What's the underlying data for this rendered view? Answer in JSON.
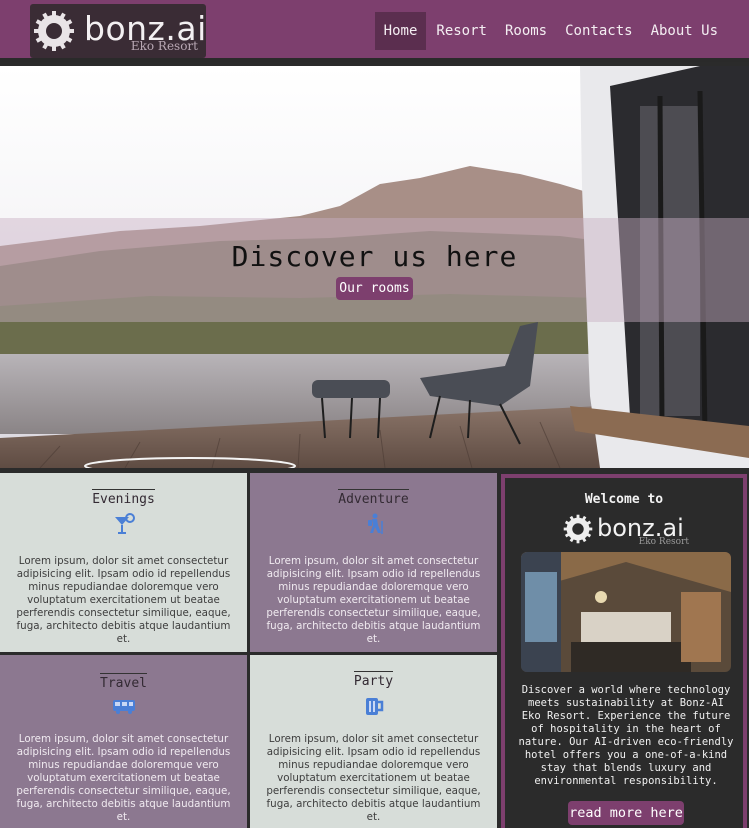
{
  "header": {
    "logo": {
      "brand": "bonz.ai",
      "subtitle": "Eko Resort",
      "icon": "gear-logo-icon"
    },
    "nav": [
      {
        "label": "Home",
        "active": true
      },
      {
        "label": "Resort",
        "active": false
      },
      {
        "label": "Rooms",
        "active": false
      },
      {
        "label": "Contacts",
        "active": false
      },
      {
        "label": "About Us",
        "active": false
      }
    ]
  },
  "hero": {
    "title": "Discover us here",
    "button_label": "Our rooms"
  },
  "cards": [
    {
      "title": "Evenings",
      "icon": "cocktail-icon",
      "text": "Lorem ipsum, dolor sit amet consectetur adipisicing elit. Ipsam odio id repellendus minus repudiandae doloremque vero voluptatum exercitationem ut beatae perferendis consectetur similique, eaque, fuga, architecto debitis atque laudantium et."
    },
    {
      "title": "Adventure",
      "icon": "hiking-icon",
      "text": "Lorem ipsum, dolor sit amet consectetur adipisicing elit. Ipsam odio id repellendus minus repudiandae doloremque vero voluptatum exercitationem ut beatae perferendis consectetur similique, eaque, fuga, architecto debitis atque laudantium et."
    },
    {
      "title": "Travel",
      "icon": "bus-icon",
      "text": "Lorem ipsum, dolor sit amet consectetur adipisicing elit. Ipsam odio id repellendus minus repudiandae doloremque vero voluptatum exercitationem ut beatae perferendis consectetur similique, eaque, fuga, architecto debitis atque laudantium et."
    },
    {
      "title": "Party",
      "icon": "beer-mug-icon",
      "text": "Lorem ipsum, dolor sit amet consectetur adipisicing elit. Ipsam odio id repellendus minus repudiandae doloremque vero voluptatum exercitationem ut beatae perferendis consectetur similique, eaque, fuga, architecto debitis atque laudantium et."
    }
  ],
  "welcome": {
    "title": "Welcome to",
    "brand": "bonz.ai",
    "subtitle": "Eko Resort",
    "text": "Discover a world where technology meets sustainability at Bonz-AI Eko Resort. Experience the future of hospitality in the heart of nature. Our AI-driven eco-friendly hotel offers you a one-of-a-kind stay that blends luxury and environmental responsibility.",
    "button_label": "read more here"
  },
  "colors": {
    "accent": "#7d3f6e",
    "dark": "#2b2b2b",
    "card_light": "#d7ddd9",
    "card_purple": "#8c7890",
    "icon_blue": "#4a7fd6"
  }
}
